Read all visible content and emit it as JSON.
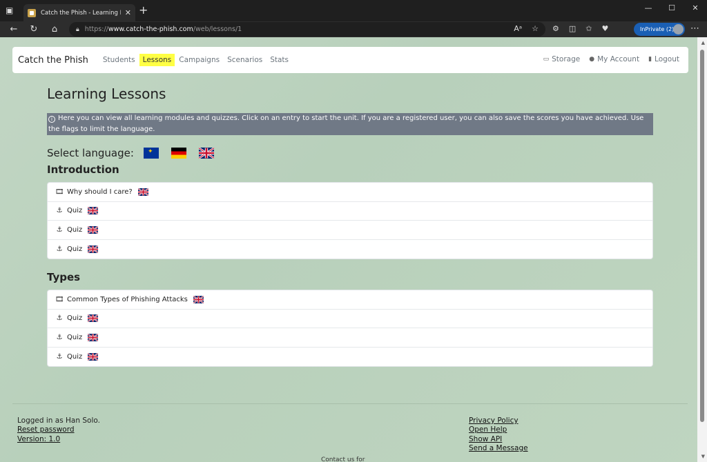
{
  "browser": {
    "tab_title": "Catch the Phish - Learning Lessons",
    "url_prefix": "https://",
    "url_host": "www.catch-the-phish.com",
    "url_path": "/web/lessons/1",
    "inprivate_label": "InPrivate (2)"
  },
  "navbar": {
    "brand": "Catch the Phish",
    "links": [
      "Students",
      "Lessons",
      "Campaigns",
      "Scenarios",
      "Stats"
    ],
    "active": "Lessons",
    "storage": "Storage",
    "account": "My Account",
    "logout": "Logout"
  },
  "page": {
    "title": "Learning Lessons",
    "info": "Here you can view all learning modules and quizzes. Click on an entry to start the unit. If you are a registered user, you can also save the scores you have achieved. Use the flags to limit the language.",
    "select_language": "Select language:"
  },
  "sections": [
    {
      "title": "Introduction",
      "items": [
        {
          "label": "Why should I care?",
          "icon": "film-icon"
        },
        {
          "label": "Quiz",
          "icon": "anchor-icon"
        },
        {
          "label": "Quiz",
          "icon": "anchor-icon"
        },
        {
          "label": "Quiz",
          "icon": "anchor-icon"
        }
      ]
    },
    {
      "title": "Types",
      "items": [
        {
          "label": "Common Types of Phishing Attacks",
          "icon": "film-icon"
        },
        {
          "label": "Quiz",
          "icon": "anchor-icon"
        },
        {
          "label": "Quiz",
          "icon": "anchor-icon"
        },
        {
          "label": "Quiz",
          "icon": "anchor-icon"
        }
      ]
    }
  ],
  "footer": {
    "logged_in": "Logged in as Han Solo.",
    "reset_password": "Reset password",
    "version": "Version: 1.0",
    "privacy": "Privacy Policy",
    "help": "Open Help",
    "api": "Show API",
    "message": "Send a Message",
    "contact": "Contact us for"
  },
  "colors": {
    "active_nav_highlight": "#ffff44",
    "info_box": "#707986",
    "background": "#bfd5c0"
  }
}
